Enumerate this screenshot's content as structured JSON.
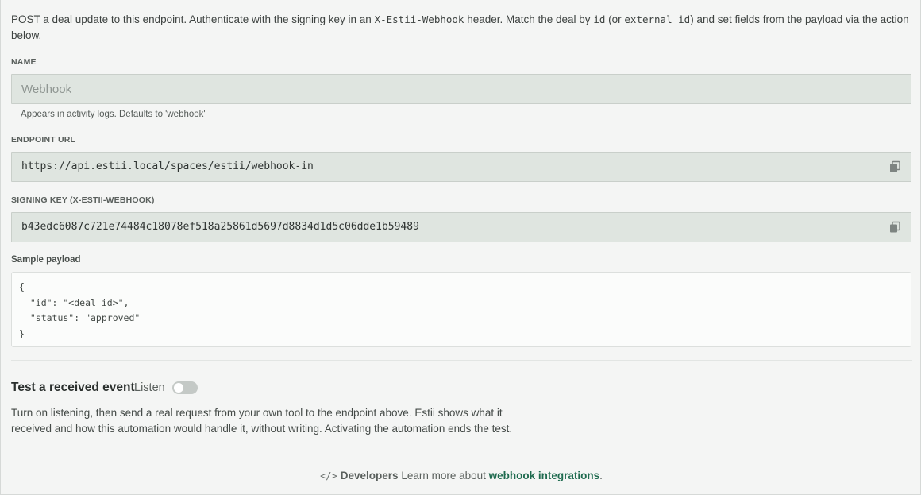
{
  "intro": {
    "part1": "POST a deal update to this endpoint. Authenticate with the signing key in an ",
    "header_name": "X-Estii-Webhook",
    "part2": " header. Match the deal by ",
    "id_field": "id",
    "part3": " (or ",
    "external_id_field": "external_id",
    "part4": ") and set fields from the payload via the action below."
  },
  "name_field": {
    "label": "NAME",
    "placeholder": "Webhook",
    "value": "",
    "help": "Appears in activity logs. Defaults to 'webhook'"
  },
  "endpoint": {
    "label": "ENDPOINT URL",
    "value": "https://api.estii.local/spaces/estii/webhook-in",
    "copy_icon": "copy-icon"
  },
  "signing_key": {
    "label": "SIGNING KEY (X-ESTII-WEBHOOK)",
    "value": "b43edc6087c721e74484c18078ef518a25861d5697d8834d1d5c06dde1b59489",
    "copy_icon": "copy-icon"
  },
  "sample": {
    "label": "Sample payload",
    "payload": "{\n  \"id\": \"<deal id>\",\n  \"status\": \"approved\"\n}"
  },
  "test": {
    "title": "Test a received event",
    "listen_label": "Listen",
    "listen_on": false,
    "description": "Turn on listening, then send a real request from your own tool to the endpoint above. Estii shows what it received and how this automation would handle it, without writing. Activating the automation ends the test."
  },
  "footer": {
    "icon": "code-icon",
    "developers_label": "Developers",
    "text": " Learn more about ",
    "link_label": "webhook integrations",
    "trailing": "."
  },
  "colors": {
    "accent": "#1f6b4f",
    "field_bg": "#dfe5e0",
    "page_bg": "#f4f5f4"
  }
}
